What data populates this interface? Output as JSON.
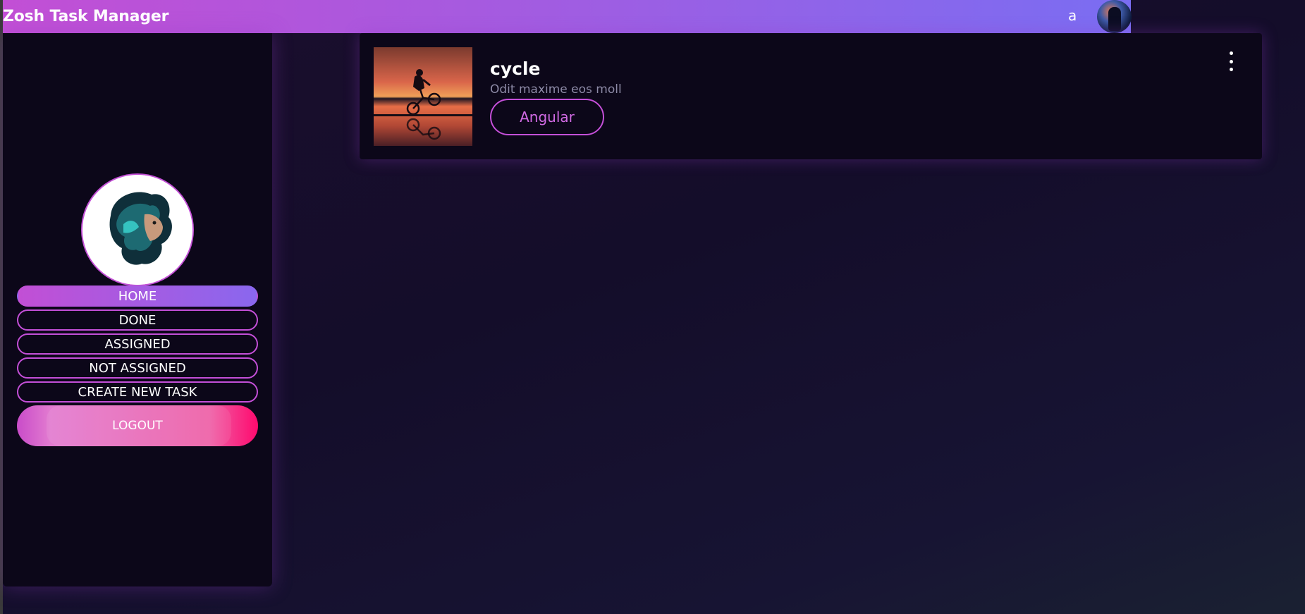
{
  "header": {
    "title": "Zosh Task Manager",
    "user_initial": "a"
  },
  "sidebar": {
    "items": [
      {
        "label": "HOME",
        "active": true
      },
      {
        "label": "DONE",
        "active": false
      },
      {
        "label": "ASSIGNED",
        "active": false
      },
      {
        "label": "NOT ASSIGNED",
        "active": false
      },
      {
        "label": "CREATE NEW TASK",
        "active": false
      }
    ],
    "logout_label": "LOGOUT"
  },
  "task": {
    "title": "cycle",
    "description": "Odit maxime eos moll",
    "tag": "Angular"
  },
  "colors": {
    "accent": "#c44fd8",
    "accent_blue": "#7a6df2",
    "logout_pink": "#ff0a6e",
    "panel": "#0c0719"
  },
  "icons": {
    "menu": "more-vertical-icon"
  }
}
